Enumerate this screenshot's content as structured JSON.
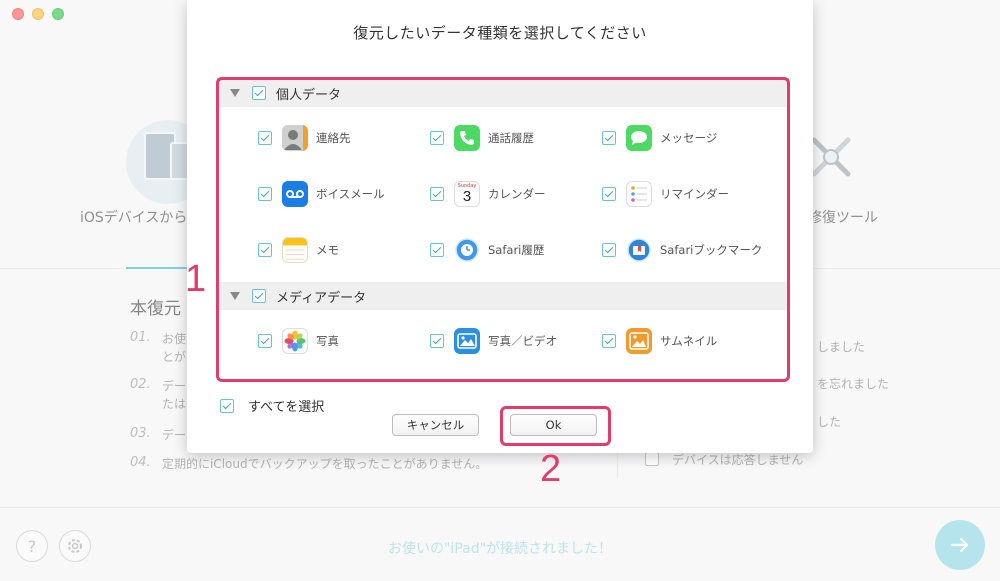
{
  "background": {
    "left_tool_label": "iOSデバイスから",
    "right_tool_label": "修復ツール",
    "heading": "本復元",
    "steps": [
      {
        "num": "01.",
        "lines": [
          "お使",
          "とが"
        ]
      },
      {
        "num": "02.",
        "lines": [
          "デー",
          "たは"
        ]
      },
      {
        "num": "03.",
        "lines": [
          "デー"
        ]
      },
      {
        "num": "04.",
        "lines": [
          "定期的にiCloudでバックアップを取ったことがありません。"
        ]
      }
    ],
    "right_notes": [
      "しました",
      "を忘れました",
      "した",
      "デバイスは応答しません"
    ],
    "status_text": "お使いの\"iPad\"が接続されました！"
  },
  "modal": {
    "title": "復元したいデータ種類を選択してください",
    "groups": [
      {
        "label": "個人データ",
        "items": [
          {
            "label": "連絡先",
            "icon": "contacts-icon"
          },
          {
            "label": "通話履歴",
            "icon": "phone-icon"
          },
          {
            "label": "メッセージ",
            "icon": "messages-icon"
          },
          {
            "label": "ボイスメール",
            "icon": "voicemail-icon"
          },
          {
            "label": "カレンダー",
            "icon": "calendar-icon"
          },
          {
            "label": "リマインダー",
            "icon": "reminders-icon"
          },
          {
            "label": "メモ",
            "icon": "notes-icon"
          },
          {
            "label": "Safari履歴",
            "icon": "safari-history-icon"
          },
          {
            "label": "Safariブックマーク",
            "icon": "safari-bookmark-icon"
          }
        ]
      },
      {
        "label": "メディアデータ",
        "items": [
          {
            "label": "写真",
            "icon": "photos-icon"
          },
          {
            "label": "写真／ビデオ",
            "icon": "photo-video-icon"
          },
          {
            "label": "サムネイル",
            "icon": "thumbnail-icon"
          }
        ]
      }
    ],
    "calendar_day": "3",
    "calendar_weekday": "Sunday",
    "select_all_label": "すべてを選択",
    "cancel_label": "キャンセル",
    "ok_label": "Ok"
  },
  "annotations": {
    "first": "1",
    "second": "2",
    "color": "#e23c6c"
  }
}
